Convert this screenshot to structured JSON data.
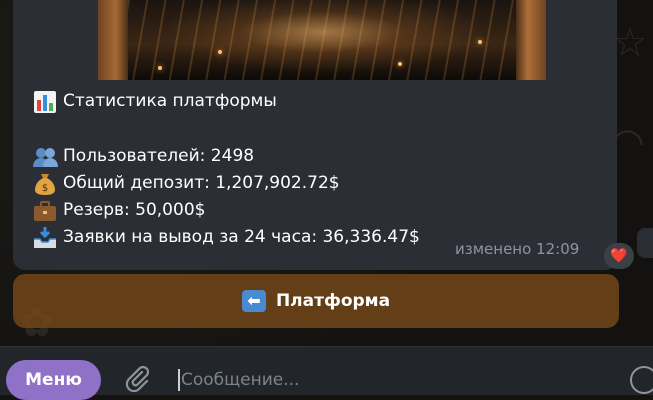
{
  "message": {
    "title": "Статистика платформы",
    "users": "Пользователей: 2498",
    "deposit": "Общий депозит: 1,207,902.72$",
    "reserve": "Резерв: 50,000$",
    "withdrawals": "Заявки на вывод за 24 часа: 36,336.47$",
    "edited_time": "изменено 12:09",
    "reaction": "❤️",
    "icons": {
      "title": "bar-chart-icon",
      "users": "users-icon",
      "deposit": "money-bag-icon",
      "reserve": "briefcase-icon",
      "withdrawals": "inbox-tray-icon"
    }
  },
  "keyboard": {
    "button_label": "Платформа",
    "button_icon": "left-arrow-icon"
  },
  "composer": {
    "menu_label": "Меню",
    "placeholder": "Сообщение..."
  },
  "colors": {
    "bubble": "#2b2e35",
    "keyboard_button": "#7a4a18",
    "menu_button": "#8f71c8",
    "composer": "#22262b"
  }
}
